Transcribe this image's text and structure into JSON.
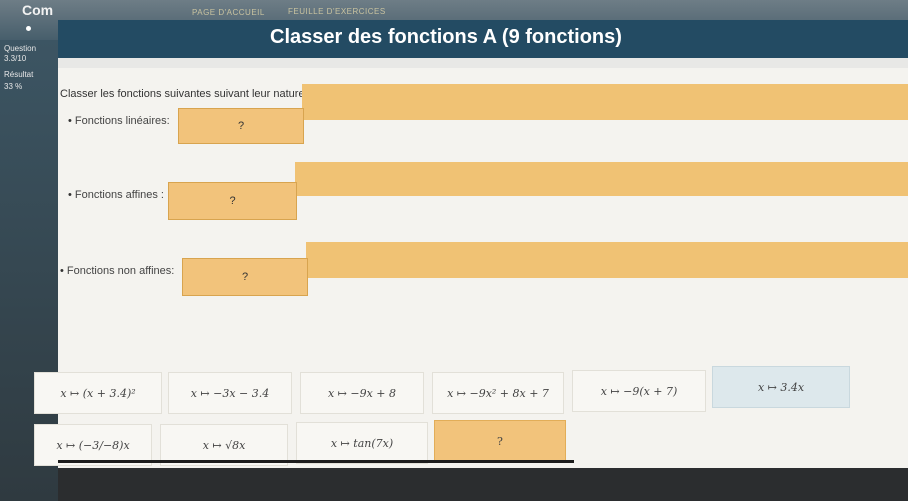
{
  "topbar": {
    "brand": "Com",
    "tab_course": "PAGE D'ACCUEIL",
    "tab_exercises": "FEUILLE D'EXERCICES"
  },
  "sidebar": {
    "question_label": "Question",
    "question_value": "3.3/10",
    "result_label": "Résultat",
    "result_value": "33 %"
  },
  "header": {
    "title": "Classer des fonctions A (9 fonctions)"
  },
  "instruction": "Classer les fonctions suivantes suivant leur nature:",
  "categories": [
    {
      "label": "Fonctions linéaires:",
      "placeholder": "?"
    },
    {
      "label": "Fonctions affines :",
      "placeholder": "?"
    },
    {
      "label": "Fonctions non affines:",
      "placeholder": "?"
    }
  ],
  "cards": [
    {
      "text": "x ↦ (x + 3.4)²"
    },
    {
      "text": "x ↦ −3x − 3.4"
    },
    {
      "text": "x ↦ −9x + 8"
    },
    {
      "text": "x ↦ −9x² + 8x + 7"
    },
    {
      "text": "x ↦ −9(x + 7)"
    },
    {
      "text": "x ↦ 3.4x"
    },
    {
      "text": "x ↦ (−3/−8)x"
    },
    {
      "text": "x ↦ √8x"
    },
    {
      "text": "x ↦ tan(7x)"
    },
    {
      "text": "?"
    }
  ]
}
